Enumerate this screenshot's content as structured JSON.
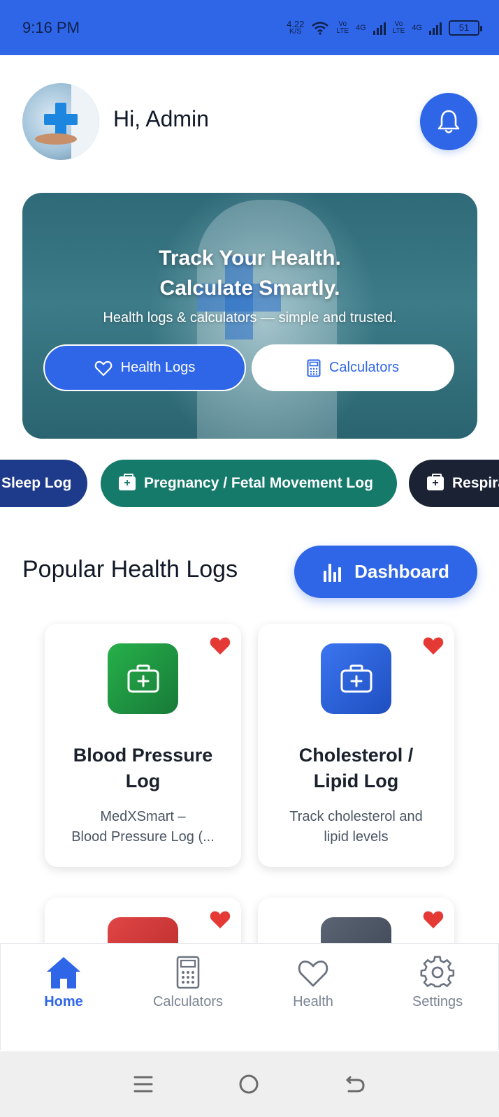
{
  "status_bar": {
    "time": "9:16 PM",
    "net_speed_value": "4.22",
    "net_speed_unit": "K/S",
    "sim1_label_top": "Vo",
    "sim1_label_bottom": "LTE",
    "sim1_gen": "4G",
    "sim2_label_top": "Vo",
    "sim2_label_bottom": "LTE",
    "sim2_gen": "4G",
    "battery": "51"
  },
  "header": {
    "greeting": "Hi, Admin"
  },
  "hero": {
    "title_line1": "Track Your Health.",
    "title_line2": "Calculate Smartly.",
    "subtitle": "Health logs & calculators — simple and trusted.",
    "primary_button": "Health Logs",
    "secondary_button": "Calculators"
  },
  "chips": [
    {
      "label": "Sleep Log",
      "color": "#1e3a8a"
    },
    {
      "label": "Pregnancy / Fetal Movement Log",
      "color": "#167a6a"
    },
    {
      "label": "Respira",
      "color": "#1a2234"
    }
  ],
  "section": {
    "title": "Popular Health Logs",
    "dashboard_button": "Dashboard"
  },
  "cards": [
    {
      "title_line1": "Blood Pressure",
      "title_line2": "Log",
      "desc_line1": "MedXSmart –",
      "desc_line2": "Blood Pressure Log (...",
      "icon": "medical-kit-icon",
      "color": "#22a444",
      "favorite": true
    },
    {
      "title_line1": "Cholesterol /",
      "title_line2": "Lipid Log",
      "desc_line1": "Track cholesterol and",
      "desc_line2": "lipid levels",
      "icon": "medical-kit-icon",
      "color": "#2f66e8",
      "favorite": true
    },
    {
      "icon": "medical-kit-icon",
      "color": "#d63a3a",
      "favorite": true
    },
    {
      "icon": "medical-kit-icon",
      "color": "#4b5361",
      "favorite": true
    }
  ],
  "bottom_nav": [
    {
      "label": "Home",
      "icon": "home-icon",
      "active": true
    },
    {
      "label": "Calculators",
      "icon": "calculator-icon",
      "active": false
    },
    {
      "label": "Health",
      "icon": "heart-icon",
      "active": false
    },
    {
      "label": "Settings",
      "icon": "gear-icon",
      "active": false
    }
  ],
  "colors": {
    "primary": "#2f66e8",
    "favorite": "#e53935"
  }
}
